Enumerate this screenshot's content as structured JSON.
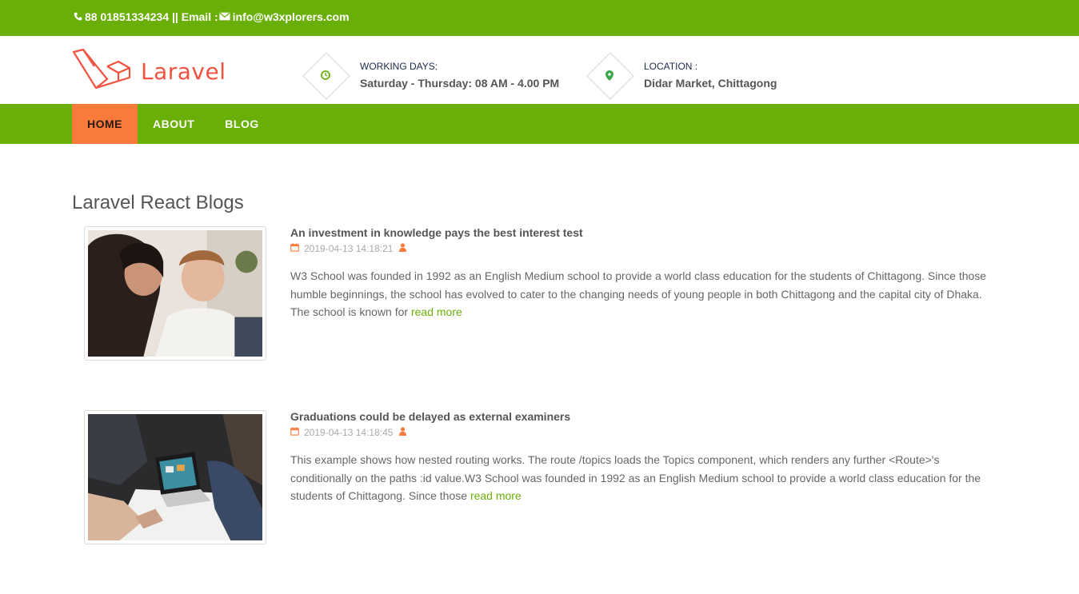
{
  "topbar": {
    "phone": "88 01851334234",
    "separator": "||",
    "email_label": "Email :",
    "email": "info@w3xplorers.com"
  },
  "brand": {
    "name": "Laravel"
  },
  "info": [
    {
      "label": "WORKING DAYS:",
      "value": "Saturday - Thursday: 08 AM - 4.00 PM",
      "icon": "clock-icon"
    },
    {
      "label": "LOCATION :",
      "value": "Didar Market, Chittagong",
      "icon": "map-marker-icon"
    }
  ],
  "nav": [
    {
      "label": "HOME",
      "active": true
    },
    {
      "label": "ABOUT",
      "active": false
    },
    {
      "label": "BLOG",
      "active": false
    }
  ],
  "page_title": "Laravel React Blogs",
  "posts": [
    {
      "title": "An investment in knowledge pays the best interest test",
      "date": "2019-04-13 14:18:21",
      "excerpt": "W3 School was founded in 1992 as an English Medium school to provide a world class education for the students of Chittagong. Since those humble beginnings, the school has evolved to cater to the changing needs of young people in both Chittagong and the capital city of Dhaka. The school is known for",
      "read_more": "read more"
    },
    {
      "title": "Graduations could be delayed as external examiners",
      "date": "2019-04-13 14:18:45",
      "excerpt": "This example shows how nested routing works. The route /topics loads the Topics component, which renders any further <Route>'s conditionally on the paths :id value.W3 School was founded in 1992 as an English Medium school to provide a world class education for the students of Chittagong. Since those",
      "read_more": "read more"
    }
  ],
  "colors": {
    "brand_green": "#6aaf08",
    "accent_orange": "#f97a3a",
    "logo_red": "#f05340"
  }
}
